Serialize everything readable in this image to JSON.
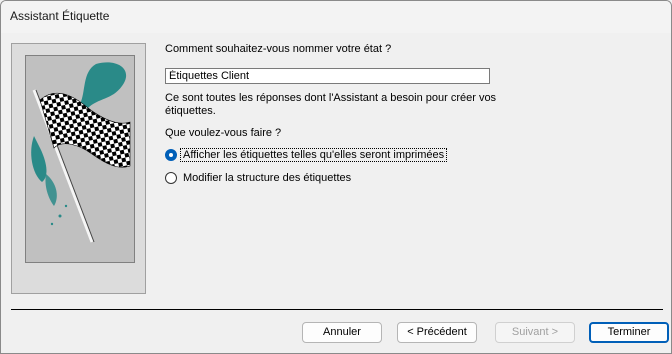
{
  "window": {
    "title": "Assistant Étiquette"
  },
  "form": {
    "question_name": "Comment souhaitez-vous nommer votre état ?",
    "report_name_value": "Étiquettes Client",
    "info_text": "Ce sont toutes les réponses dont l'Assistant a besoin pour créer vos étiquettes.",
    "question_action": "Que voulez-vous faire ?",
    "options": [
      {
        "label": "Afficher les étiquettes telles qu'elles seront imprimées",
        "selected": true
      },
      {
        "label": "Modifier la structure des étiquettes",
        "selected": false
      }
    ]
  },
  "buttons": {
    "cancel": "Annuler",
    "previous": "< Précédent",
    "next": "Suivant >",
    "finish": "Terminer"
  },
  "illustration": {
    "icon": "checkered-flag-icon",
    "accent": "#2a8a88"
  },
  "colors": {
    "accent": "#005fb8"
  }
}
